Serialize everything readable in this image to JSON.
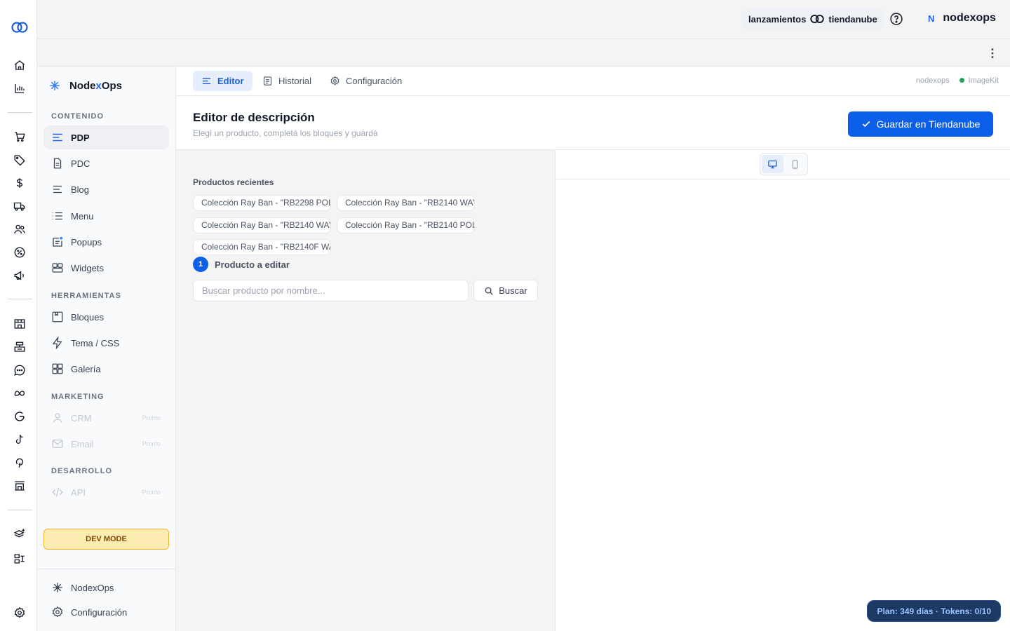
{
  "topbar": {
    "launch_left": "lanzamientos",
    "launch_right": "tiendanube",
    "avatar_initial": "N",
    "username": "nodexops"
  },
  "sidebar": {
    "brand_pre": "Node",
    "brand_x": "x",
    "brand_post": "Ops",
    "sections": {
      "contenido": "CONTENIDO",
      "herramientas": "HERRAMIENTAS",
      "marketing": "MARKETING",
      "desarrollo": "DESARROLLO"
    },
    "items": {
      "pdp": "PDP",
      "pdc": "PDC",
      "blog": "Blog",
      "menu": "Menu",
      "popups": "Popups",
      "widgets": "Widgets",
      "bloques": "Bloques",
      "tema": "Tema / CSS",
      "galeria": "Galería",
      "crm": "CRM",
      "email": "Email",
      "api": "API"
    },
    "soon_label": "Pronto",
    "dev_mode": "DEV MODE",
    "footer": {
      "nodexops": "NodexOps",
      "config": "Configuración"
    }
  },
  "tabs": {
    "editor": "Editor",
    "historial": "Historial",
    "configuracion": "Configuración"
  },
  "status": {
    "store": "nodexops",
    "service": "ImageKit",
    "service_color": "#22a559"
  },
  "header": {
    "title": "Editor de descripción",
    "subtitle": "Elegí un producto, completá los bloques y guardá",
    "save_label": "Guardar en Tiendanube"
  },
  "editor": {
    "recent_title": "Productos recientes",
    "recent_products": [
      "Colección Ray Ban - \"RB2298 POL",
      "Colección Ray Ban - \"RB2140 WAY",
      "Colección Ray Ban - \"RB2140 WAY",
      "Colección Ray Ban - \"RB2140 POL",
      "Colección Ray Ban - \"RB2140F WA"
    ],
    "step_number": "1",
    "step_label": "Producto a editar",
    "search_placeholder": "Buscar producto por nombre...",
    "search_button": "Buscar"
  },
  "plan_badge": "Plan: 349 días · Tokens: 0/10",
  "colors": {
    "accent": "#0b5fe8",
    "plan_badge_bg": "#1c3a63",
    "dev_mode_bg": "#fdecb2"
  }
}
